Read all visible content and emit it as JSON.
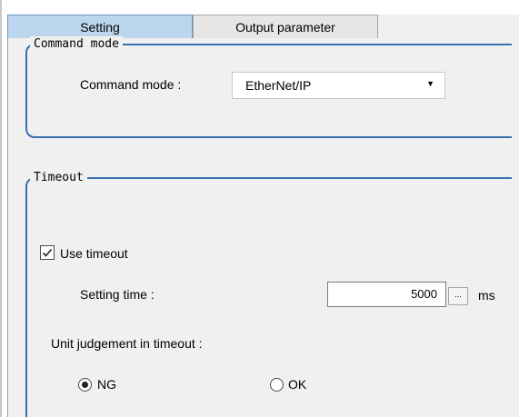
{
  "tabs": [
    {
      "label": "Setting",
      "active": true
    },
    {
      "label": "Output parameter",
      "active": false
    }
  ],
  "command_mode_group": {
    "title": "Command mode",
    "field_label": "Command mode :",
    "selected_value": "EtherNet/IP"
  },
  "timeout_group": {
    "title": "Timeout",
    "use_timeout_label": "Use timeout",
    "use_timeout_checked": true,
    "setting_time_label": "Setting time :",
    "setting_time_value": "5000",
    "ellipsis_label": "...",
    "unit": "ms",
    "judgement_label": "Unit judgement in timeout :",
    "judgement_options": [
      {
        "label": "NG",
        "selected": true
      },
      {
        "label": "OK",
        "selected": false
      }
    ]
  },
  "colors": {
    "tab_active_bg": "#bcd6ee",
    "group_border": "#3a6fb0",
    "panel_bg": "#f0f0f0"
  }
}
